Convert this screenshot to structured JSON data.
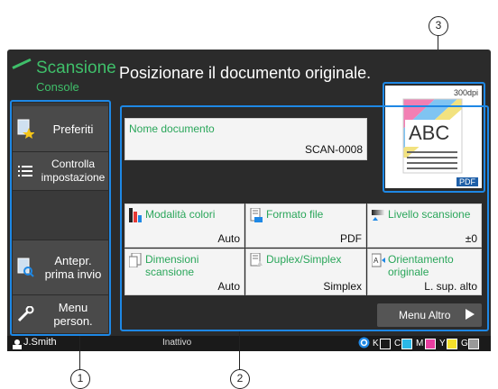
{
  "header": {
    "app_title": "Scansione",
    "app_subtitle": "Console",
    "message": "Posizionare il documento originale."
  },
  "sidebar": {
    "items": [
      {
        "label": "Preferiti"
      },
      {
        "label": "Controlla\nimpostazione"
      },
      {
        "label": "Antepr.\nprima invio"
      },
      {
        "label": "Menu\nperson."
      }
    ]
  },
  "document": {
    "label": "Nome documento",
    "value": "SCAN-0008"
  },
  "settings": [
    {
      "label": "Modalità colori",
      "value": "Auto",
      "icon": "color-mode-icon"
    },
    {
      "label": "Formato file",
      "value": "PDF",
      "icon": "file-format-icon"
    },
    {
      "label": "Livello scansione",
      "value": "±0",
      "icon": "scan-level-icon"
    },
    {
      "label": "Dimensioni scansione",
      "value": "Auto",
      "icon": "scan-size-icon"
    },
    {
      "label": "Duplex/Simplex",
      "value": "Simplex",
      "icon": "duplex-icon"
    },
    {
      "label": "Orientamento originale",
      "value": "L. sup. alto",
      "icon": "orientation-icon"
    }
  ],
  "menu_more": {
    "label": "Menu Altro"
  },
  "preview": {
    "dpi": "300dpi",
    "sample_text": "ABC",
    "format_badge": "PDF"
  },
  "status": {
    "user": "J.Smith",
    "state": "Inattivo",
    "inks": [
      "K",
      "C",
      "M",
      "Y",
      "G"
    ]
  },
  "callouts": [
    "1",
    "2",
    "3"
  ],
  "colors": {
    "accent": "#3fbf6a",
    "callout": "#1e88e5"
  }
}
